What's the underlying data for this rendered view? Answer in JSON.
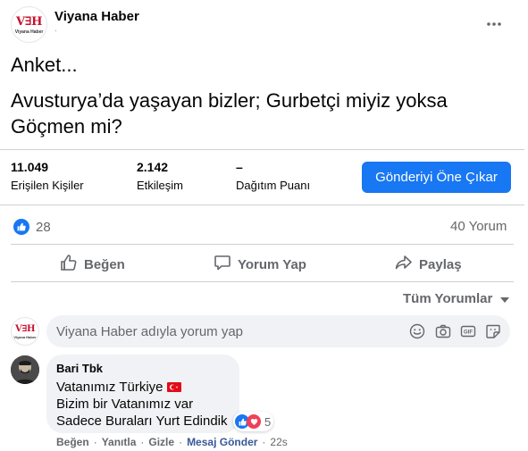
{
  "page": {
    "name": "Viyana Haber",
    "meta": "·"
  },
  "logo": {
    "text": "V∃H",
    "subtitle": "Viyana Haber"
  },
  "post": {
    "title": "Anket...",
    "body": "Avusturya’da yaşayan bizler; Gurbetçi miyiz yoksa Göçmen mi?"
  },
  "insights": {
    "reach_value": "11.049",
    "reach_label": "Erişilen Kişiler",
    "engagement_value": "2.142",
    "engagement_label": "Etkileşim",
    "distribution_value": "–",
    "distribution_label": "Dağıtım Puanı",
    "boost_label": "Gönderiyi Öne Çıkar"
  },
  "reactions": {
    "count": "28",
    "comments": "40 Yorum"
  },
  "actions": {
    "like": "Beğen",
    "comment": "Yorum Yap",
    "share": "Paylaş"
  },
  "sort": {
    "label": "Tüm Yorumlar"
  },
  "composer": {
    "placeholder": "Viyana Haber adıyla yorum yap"
  },
  "comment": {
    "author": "Bari Tbk",
    "line1": "Vatanımız Türkiye",
    "line2": "Bizim bir Vatanımız var",
    "line3": "Sadece Buraları Yurt Edindik",
    "reaction_count": "5",
    "like": "Beğen",
    "reply": "Yanıtla",
    "hide": "Gizle",
    "message": "Mesaj Gönder",
    "time": "22s",
    "sep": "·"
  },
  "colors": {
    "accent": "#1877f2",
    "muted": "#65676b",
    "brand": "#c8102e",
    "love": "#f33e58"
  }
}
